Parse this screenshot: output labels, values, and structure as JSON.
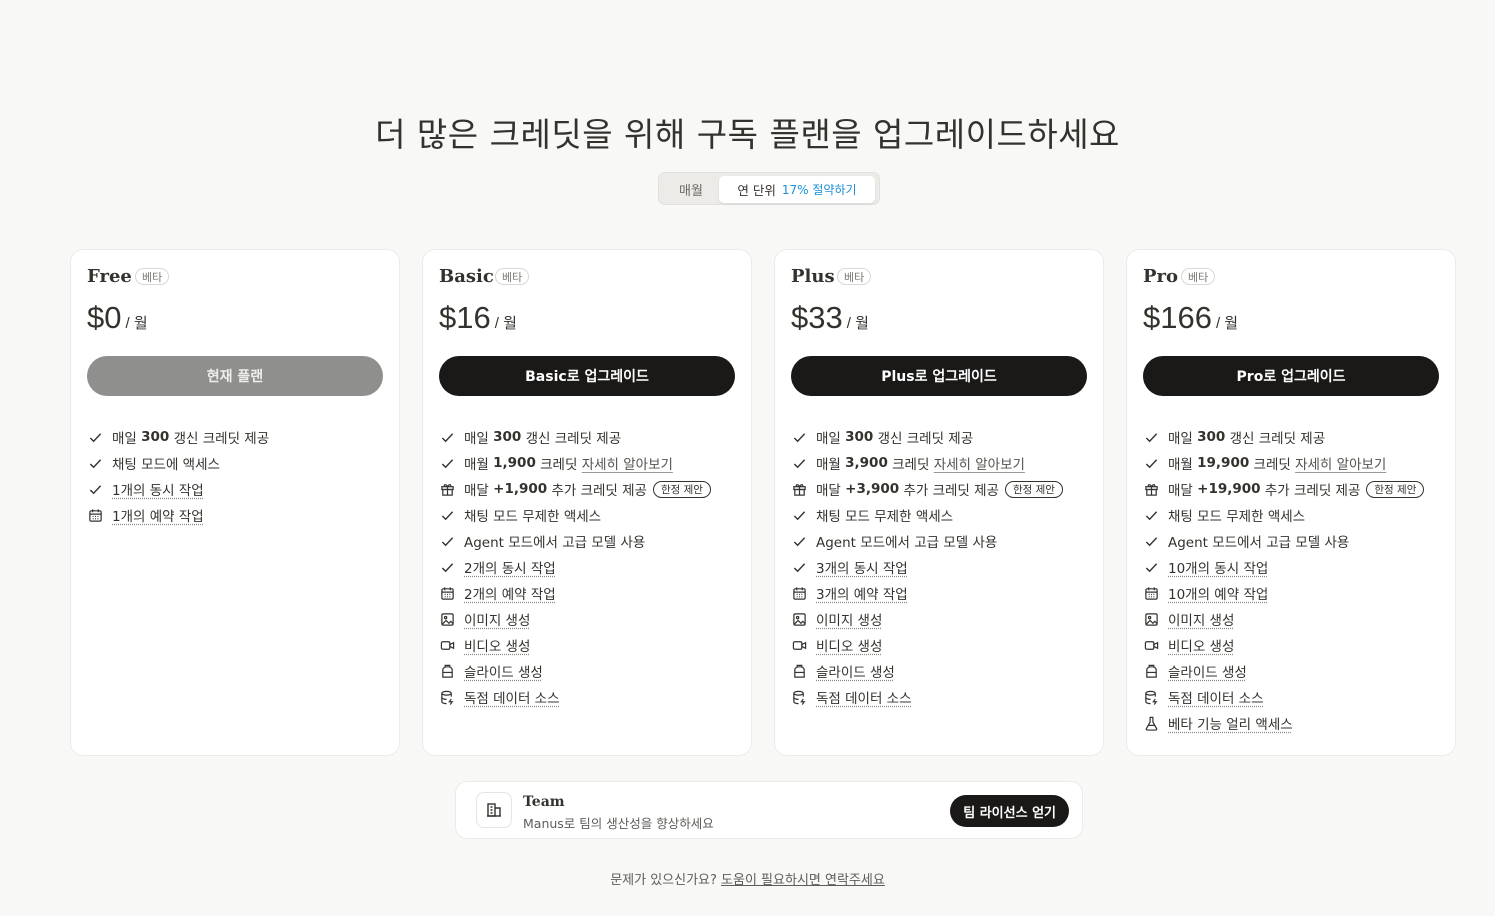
{
  "page": {
    "title": "더 많은 크레딧을 위해 구독 플랜을 업그레이드하세요"
  },
  "billing_toggle": {
    "monthly_label": "매월",
    "yearly_label": "연 단위",
    "yearly_discount": "17% 절약하기",
    "selected": "yearly"
  },
  "plans": [
    {
      "name": "Free",
      "badge": "베타",
      "price": "$0",
      "per": "/ 월",
      "button_label": "현재 플랜",
      "button_state": "current",
      "features": [
        {
          "icon": "check-icon",
          "pre": "매일 ",
          "bold": "300",
          "text": " 갱신 크레딧 제공"
        },
        {
          "icon": "check-icon",
          "text": "채팅 모드에 액세스"
        },
        {
          "icon": "check-icon",
          "text": "1개의 동시 작업",
          "underline": true
        },
        {
          "icon": "calendar-icon",
          "text": "1개의 예약 작업",
          "underline": true
        }
      ]
    },
    {
      "name": "Basic",
      "badge": "베타",
      "price": "$16",
      "per": "/ 월",
      "button_label": "Basic로 업그레이드",
      "button_state": "upgrade",
      "features": [
        {
          "icon": "check-icon",
          "pre": "매일 ",
          "bold": "300",
          "text": " 갱신 크레딧 제공"
        },
        {
          "icon": "check-icon",
          "pre": "매월 ",
          "bold": "1,900",
          "text": " 크레딧 ",
          "link": "자세히 알아보기"
        },
        {
          "icon": "gift-icon",
          "pre": "매달 ",
          "bold": "+1,900",
          "text": " 추가 크레딧 제공",
          "tag": "한정 제안"
        },
        {
          "icon": "check-icon",
          "text": "채팅 모드 무제한 액세스"
        },
        {
          "icon": "check-icon",
          "text": "Agent 모드에서 고급 모델 사용"
        },
        {
          "icon": "check-icon",
          "text": "2개의 동시 작업",
          "underline": true
        },
        {
          "icon": "calendar-icon",
          "text": "2개의 예약 작업",
          "underline": true
        },
        {
          "icon": "image-icon",
          "text": "이미지 생성",
          "underline": true
        },
        {
          "icon": "video-icon",
          "text": "비디오 생성",
          "underline": true
        },
        {
          "icon": "slides-icon",
          "text": "슬라이드 생성",
          "underline": true
        },
        {
          "icon": "database-icon",
          "text": "독점 데이터 소스",
          "underline": true
        }
      ]
    },
    {
      "name": "Plus",
      "badge": "베타",
      "price": "$33",
      "per": "/ 월",
      "button_label": "Plus로 업그레이드",
      "button_state": "upgrade",
      "features": [
        {
          "icon": "check-icon",
          "pre": "매일 ",
          "bold": "300",
          "text": " 갱신 크레딧 제공"
        },
        {
          "icon": "check-icon",
          "pre": "매월 ",
          "bold": "3,900",
          "text": " 크레딧 ",
          "link": "자세히 알아보기"
        },
        {
          "icon": "gift-icon",
          "pre": "매달 ",
          "bold": "+3,900",
          "text": " 추가 크레딧 제공",
          "tag": "한정 제안"
        },
        {
          "icon": "check-icon",
          "text": "채팅 모드 무제한 액세스"
        },
        {
          "icon": "check-icon",
          "text": "Agent 모드에서 고급 모델 사용"
        },
        {
          "icon": "check-icon",
          "text": "3개의 동시 작업",
          "underline": true
        },
        {
          "icon": "calendar-icon",
          "text": "3개의 예약 작업",
          "underline": true
        },
        {
          "icon": "image-icon",
          "text": "이미지 생성",
          "underline": true
        },
        {
          "icon": "video-icon",
          "text": "비디오 생성",
          "underline": true
        },
        {
          "icon": "slides-icon",
          "text": "슬라이드 생성",
          "underline": true
        },
        {
          "icon": "database-icon",
          "text": "독점 데이터 소스",
          "underline": true
        }
      ]
    },
    {
      "name": "Pro",
      "badge": "베타",
      "price": "$166",
      "per": "/ 월",
      "button_label": "Pro로 업그레이드",
      "button_state": "upgrade",
      "features": [
        {
          "icon": "check-icon",
          "pre": "매일 ",
          "bold": "300",
          "text": " 갱신 크레딧 제공"
        },
        {
          "icon": "check-icon",
          "pre": "매월 ",
          "bold": "19,900",
          "text": " 크레딧 ",
          "link": "자세히 알아보기"
        },
        {
          "icon": "gift-icon",
          "pre": "매달 ",
          "bold": "+19,900",
          "text": " 추가 크레딧 제공",
          "tag": "한정 제안"
        },
        {
          "icon": "check-icon",
          "text": "채팅 모드 무제한 액세스"
        },
        {
          "icon": "check-icon",
          "text": "Agent 모드에서 고급 모델 사용"
        },
        {
          "icon": "check-icon",
          "text": "10개의 동시 작업",
          "underline": true
        },
        {
          "icon": "calendar-icon",
          "text": "10개의 예약 작업",
          "underline": true
        },
        {
          "icon": "image-icon",
          "text": "이미지 생성",
          "underline": true
        },
        {
          "icon": "video-icon",
          "text": "비디오 생성",
          "underline": true
        },
        {
          "icon": "slides-icon",
          "text": "슬라이드 생성",
          "underline": true
        },
        {
          "icon": "database-icon",
          "text": "독점 데이터 소스",
          "underline": true
        },
        {
          "icon": "flask-icon",
          "text": "베타 기능 얼리 액세스",
          "underline": true
        }
      ]
    }
  ],
  "team": {
    "title": "Team",
    "subtitle": "Manus로 팀의 생산성을 향상하세요",
    "button_label": "팀 라이선스 얻기",
    "icon": "building-icon"
  },
  "footer": {
    "question": "문제가 있으신가요?",
    "link": "도움이 필요하시면 연락주세요"
  },
  "colors": {
    "background": "#f8f8f7",
    "text": "#34322d",
    "dark_button": "#1a1918",
    "current_button": "#8f8f8d",
    "discount_accent": "#1a8fd8"
  }
}
